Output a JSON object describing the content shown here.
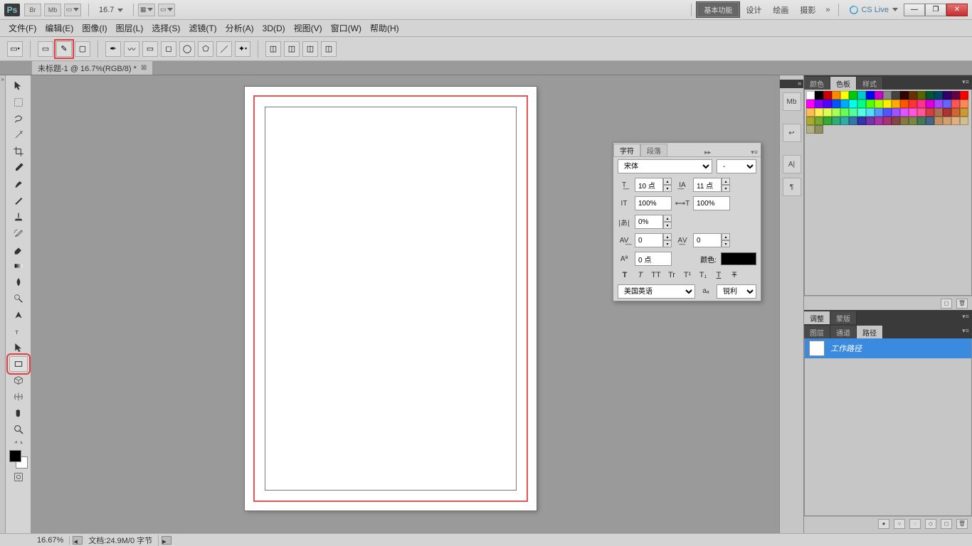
{
  "app": {
    "logo_text": "Ps",
    "mini1": "Br",
    "mini2": "Mb",
    "zoom_dropdown": "16.7"
  },
  "workspace": {
    "active": "基本功能",
    "links": [
      "设计",
      "绘画",
      "摄影"
    ],
    "more": "»",
    "cslive": "CS Live"
  },
  "menubar": [
    "文件(F)",
    "编辑(E)",
    "图像(I)",
    "图层(L)",
    "选择(S)",
    "滤镜(T)",
    "分析(A)",
    "3D(D)",
    "视图(V)",
    "窗口(W)",
    "帮助(H)"
  ],
  "doc_tab": {
    "label": "未标题-1 @ 16.7%(RGB/8) *"
  },
  "char_panel": {
    "tabs": [
      "字符",
      "段落"
    ],
    "font_family": "宋体",
    "font_style": "-",
    "font_size": "10 点",
    "leading": "11 点",
    "h_scale": "100%",
    "v_scale": "100%",
    "tracking": "0%",
    "kerning": "0",
    "kerning2": "0",
    "baseline": "0 点",
    "color_label": "颜色:",
    "styles": [
      "T",
      "T",
      "TT",
      "Tr",
      "T¹",
      "T₁",
      "T",
      "Ŧ"
    ],
    "language": "美国英语",
    "aa_label": "aₐ",
    "aa_value": "锐利"
  },
  "right": {
    "swatch_tabs": [
      "颜色",
      "色板",
      "样式"
    ],
    "swatch_colors": [
      "#ffffff",
      "#000000",
      "#cd0000",
      "#ff8800",
      "#ffff00",
      "#00cc00",
      "#00cccc",
      "#0000ff",
      "#cc00cc",
      "#888888",
      "#444444",
      "#330000",
      "#663300",
      "#556600",
      "#005533",
      "#004466",
      "#330066",
      "#660044",
      "#ff0000",
      "#ff00ff",
      "#8800ff",
      "#5500ff",
      "#0055ff",
      "#00aaff",
      "#00ffee",
      "#00ff88",
      "#55ff00",
      "#aaff00",
      "#ffee00",
      "#ffaa00",
      "#ff5500",
      "#ff3333",
      "#ff3388",
      "#dd00dd",
      "#aa44ff",
      "#6666ff",
      "#ff5555",
      "#ff8855",
      "#ffbb55",
      "#ffee55",
      "#ddff55",
      "#aaff55",
      "#66ff55",
      "#55ff99",
      "#55ffdd",
      "#55ddff",
      "#5599ff",
      "#5555ff",
      "#9955ff",
      "#dd55ff",
      "#ff55dd",
      "#ff5599",
      "#d04040",
      "#b07050",
      "#aa3333",
      "#cc6633",
      "#cc9933",
      "#aaaa33",
      "#77aa33",
      "#33aa33",
      "#33aa77",
      "#33aaaa",
      "#3377aa",
      "#3333aa",
      "#7733aa",
      "#aa33aa",
      "#aa3377",
      "#884444",
      "#887744",
      "#778844",
      "#447755",
      "#446688",
      "#c09060",
      "#d0a070",
      "#e0b080",
      "#d0c090",
      "#b0b080",
      "#909060"
    ],
    "adjust_tabs": [
      "调整",
      "蒙版"
    ],
    "layer_tabs": [
      "图层",
      "通道",
      "路径"
    ],
    "path_item": "工作路径"
  },
  "status": {
    "zoom": "16.67%",
    "docinfo": "文档:24.9M/0 字节"
  }
}
